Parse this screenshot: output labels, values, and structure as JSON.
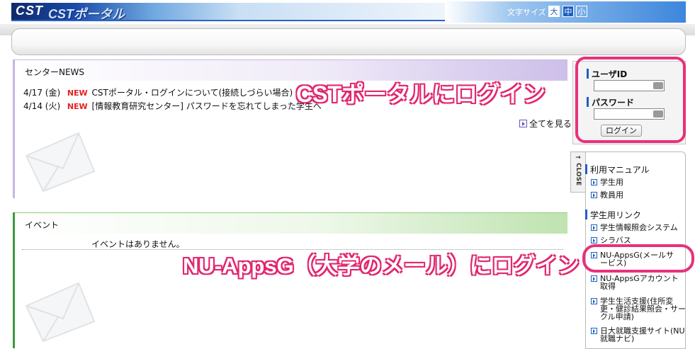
{
  "header": {
    "logo_cst": "CST",
    "logo_portal": "CSTポータル",
    "font_size_label": "文字サイズ",
    "font_sizes": [
      "大",
      "中",
      "小"
    ]
  },
  "news": {
    "title": "センターNEWS",
    "items": [
      {
        "date": "4/17 (金)",
        "badge": "NEW",
        "text": "CSTポータル・ログインについて(接続しづらい場合)"
      },
      {
        "date": "4/14 (火)",
        "badge": "NEW",
        "text": "[情報教育研究センター] パスワードを忘れてしまった学生へ"
      }
    ],
    "see_all": "全てを見る"
  },
  "event": {
    "title": "イベント",
    "empty_message": "イベントはありません。"
  },
  "login": {
    "user_id_label": "ユーザID",
    "password_label": "パスワード",
    "button": "ログイン"
  },
  "sidebar": {
    "close_label": "CLOSE",
    "manual_heading": "利用マニュアル",
    "manual_items": [
      "学生用",
      "教員用"
    ],
    "links_heading": "学生用リンク",
    "link_items": [
      "学生情報照会システム",
      "シラバス",
      "NU-AppsG(メールサービス)",
      "NU-AppsGアカウント取得",
      "学生生活支援(住所変更・健診結果照会・サークル申請)",
      "日大就職支援サイト(NU就職ナビ)"
    ]
  },
  "annotations": {
    "login_callout": "CSTポータルにログイン",
    "mail_callout": "NU-AppsG（大学のメール）にログイン",
    "highlight_color": "#e8317b"
  },
  "colors": {
    "news_accent": "#c7b6e2",
    "event_accent": "#3a9d3a",
    "link_blue": "#1f5fbf",
    "new_badge": "#e52020"
  }
}
